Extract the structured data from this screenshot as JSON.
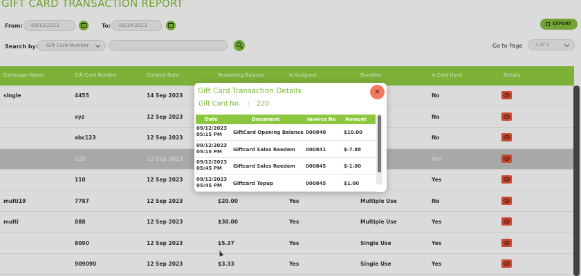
{
  "page": {
    "title": "GIFT CARD TRANSACTION REPORT"
  },
  "filters": {
    "from_label": "From:",
    "from_value": "09/13/2023",
    "to_label": "To:",
    "to_value": "09/14/2023",
    "search_label": "Search by:",
    "search_by_value": "Gift Card Number",
    "search_text": "",
    "export_label": "EXPORT",
    "goto_label": "Go to Page",
    "page_value": "1 of 5"
  },
  "table": {
    "headers": [
      "Campaign Name",
      "Gift Card Number",
      "Created Date",
      "Remaining Balance",
      "Is Assigned",
      "Duration",
      "Is Card Used",
      "Details"
    ],
    "rows": [
      [
        "single",
        "4455",
        "14 Sep 2023",
        "",
        "",
        "",
        "No"
      ],
      [
        "",
        "xyz",
        "12 Sep 2023",
        "",
        "",
        "",
        "No"
      ],
      [
        "",
        "abc123",
        "12 Sep 2023",
        "",
        "",
        "se",
        "No"
      ],
      [
        "",
        "220",
        "12 Sep 2023",
        "",
        "",
        "se",
        "Yes"
      ],
      [
        "",
        "110",
        "12 Sep 2023",
        "",
        "",
        "",
        "Yes"
      ],
      [
        "multi19",
        "7787",
        "12 Sep 2023",
        "$20.00",
        "Yes",
        "Multiple Use",
        "No"
      ],
      [
        "multi",
        "888",
        "12 Sep 2023",
        "$30.00",
        "Yes",
        "Multiple Use",
        "Yes"
      ],
      [
        "",
        "8090",
        "12 Sep 2023",
        "$5.37",
        "Yes",
        "Single Use",
        "Yes"
      ],
      [
        "",
        "909090",
        "12 Sep 2023",
        "$3.33",
        "Yes",
        "Single Use",
        "Yes"
      ]
    ]
  },
  "modal": {
    "title": "Gift Card Transaction Details",
    "card_label": "Gift Card No.",
    "card_colon": ":",
    "card_number": "220",
    "close_glyph": "×",
    "headers": [
      "Date",
      "Document",
      "Invoice No",
      "Amount"
    ],
    "rows": [
      {
        "date1": "09/12/2023",
        "date2": "05:15 PM",
        "document": "GiftCard Opening Balance",
        "invoice": "000840",
        "amount": "$10.00"
      },
      {
        "date1": "09/12/2023",
        "date2": "05:15 PM",
        "document": "Giftcard Sales Reedem",
        "invoice": "000841",
        "amount": "$-7.88"
      },
      {
        "date1": "09/12/2023",
        "date2": "05:45 PM",
        "document": "Giftcard Sales Reedem",
        "invoice": "000845",
        "amount": "$-1.00"
      },
      {
        "date1": "09/12/2023",
        "date2": "05:45 PM",
        "document": "Giftcard Topup",
        "invoice": "000845",
        "amount": "$1.00"
      }
    ]
  }
}
